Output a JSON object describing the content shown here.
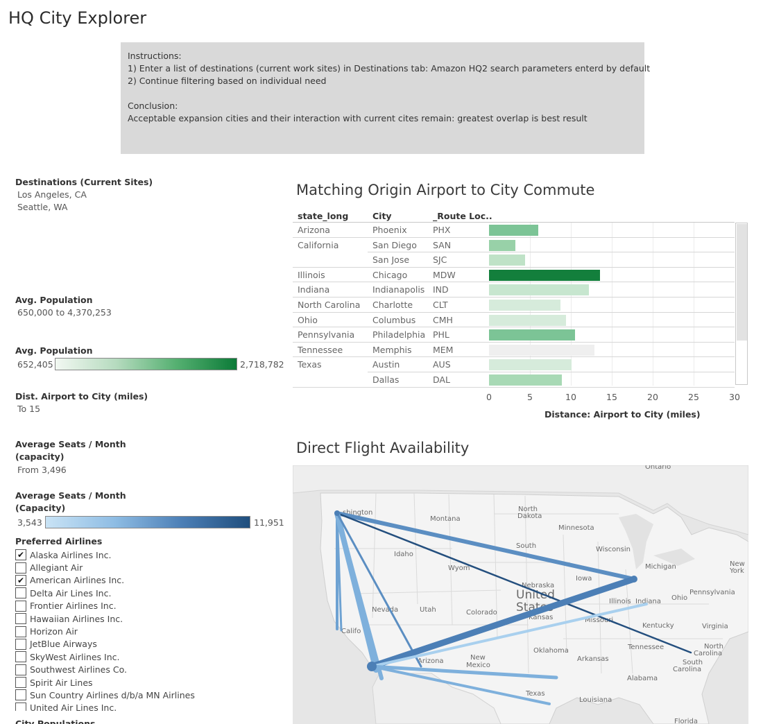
{
  "page_title": "HQ City Explorer",
  "instructions": {
    "heading": "Instructions:",
    "line1": "1) Enter a list of destinations (current work sites) in Destinations tab: Amazon HQ2 search parameters enterd by default",
    "line2": "2) Continue filtering based on individual need",
    "conclusion_heading": "Conclusion:",
    "conclusion": "Acceptable expansion cities and their interaction with current cites remain: greatest overlap is best result"
  },
  "filters": {
    "destinations": {
      "title": "Destinations (Current Sites)",
      "values": [
        "Los Angeles, CA",
        "Seattle, WA"
      ]
    },
    "avg_population_filter": {
      "title": "Avg. Population",
      "value": "650,000 to 4,370,253"
    },
    "avg_population_legend": {
      "title": "Avg. Population",
      "min": "652,405",
      "max": "2,718,782",
      "color_low": "#f2f8f2",
      "color_high": "#0c7b38"
    },
    "dist_filter": {
      "title": "Dist. Airport to City (miles)",
      "value": "To 15"
    },
    "seats_filter": {
      "title_line1": "Average Seats / Month",
      "title_line2": "(capacity)",
      "value": "From 3,496"
    },
    "seats_legend": {
      "title_line1": "Average Seats / Month",
      "title_line2": "(Capacity)",
      "min": "3,543",
      "max": "11,951",
      "color_low": "#c9e3f5",
      "color_high": "#1f4e7d"
    },
    "preferred_airlines": {
      "title": "Preferred Airlines",
      "items": [
        {
          "label": "Alaska Airlines Inc.",
          "checked": true,
          "mark": "✔"
        },
        {
          "label": "Allegiant Air",
          "checked": false,
          "mark": ""
        },
        {
          "label": "American Airlines Inc.",
          "checked": true,
          "mark": "✔"
        },
        {
          "label": "Delta Air Lines Inc.",
          "checked": false,
          "mark": ""
        },
        {
          "label": "Frontier Airlines Inc.",
          "checked": false,
          "mark": ""
        },
        {
          "label": "Hawaiian Airlines Inc.",
          "checked": false,
          "mark": ""
        },
        {
          "label": "Horizon Air",
          "checked": false,
          "mark": ""
        },
        {
          "label": "JetBlue Airways",
          "checked": false,
          "mark": ""
        },
        {
          "label": "SkyWest Airlines Inc.",
          "checked": false,
          "mark": ""
        },
        {
          "label": "Southwest Airlines Co.",
          "checked": false,
          "mark": ""
        },
        {
          "label": "Spirit Air Lines",
          "checked": false,
          "mark": ""
        },
        {
          "label": "Sun Country Airlines d/b/a MN Airlines",
          "checked": false,
          "mark": ""
        },
        {
          "label": "United Air Lines Inc.",
          "checked": false,
          "mark": ""
        }
      ]
    },
    "city_populations": {
      "title": "City Populations"
    }
  },
  "commute_table": {
    "title": "Matching Origin Airport to City Commute",
    "columns": {
      "state": "state_long",
      "city": "City",
      "route": "_Route Loc.."
    },
    "rows": [
      {
        "state": "Arizona",
        "city": "Phoenix",
        "code": "PHX",
        "distance": 6.0,
        "color": "#7cc496"
      },
      {
        "state": "California",
        "city": "San Diego",
        "code": "SAN",
        "distance": 3.2,
        "color": "#98d1a8"
      },
      {
        "state": "",
        "city": "San Jose",
        "code": "SJC",
        "distance": 4.4,
        "color": "#bfe2c7"
      },
      {
        "state": "Illinois",
        "city": "Chicago",
        "code": "MDW",
        "distance": 13.6,
        "color": "#137f3c"
      },
      {
        "state": "Indiana",
        "city": "Indianapolis",
        "code": "IND",
        "distance": 12.2,
        "color": "#c7e6cf"
      },
      {
        "state": "North Carolina",
        "city": "Charlotte",
        "code": "CLT",
        "distance": 8.7,
        "color": "#d6ebdb"
      },
      {
        "state": "Ohio",
        "city": "Columbus",
        "code": "CMH",
        "distance": 9.4,
        "color": "#d6ebdb"
      },
      {
        "state": "Pennsylvania",
        "city": "Philadelphia",
        "code": "PHL",
        "distance": 10.5,
        "color": "#7cc496"
      },
      {
        "state": "Tennessee",
        "city": "Memphis",
        "code": "MEM",
        "distance": 12.9,
        "color": "#efefef"
      },
      {
        "state": "Texas",
        "city": "Austin",
        "code": "AUS",
        "distance": 10.1,
        "color": "#d6ebdb"
      },
      {
        "state": "",
        "city": "Dallas",
        "code": "DAL",
        "distance": 8.9,
        "color": "#a8d9b5"
      }
    ],
    "x_ticks": [
      "0",
      "5",
      "10",
      "15",
      "20",
      "25",
      "30"
    ],
    "x_max": 30,
    "x_title": "Distance: Airport to City (miles)"
  },
  "flight_map": {
    "title": "Direct Flight Availability",
    "labels": [
      "Ontario",
      "shington",
      "Montana",
      "North",
      "Dakota",
      "Minnesota",
      "South",
      "Wisconsin",
      "Michigan",
      "New",
      "York",
      "Idaho",
      "Wyom",
      "Iowa",
      "Nebraska",
      "Pennsylvania",
      "Illinois",
      "Indiana",
      "Ohio",
      "United",
      "States",
      "Nevada",
      "Utah",
      "Colorado",
      "Kansas",
      "Missouri",
      "Kentucky",
      "Virginia",
      "Califo",
      "Oklahoma",
      "Tennessee",
      "North",
      "Carolina",
      "South",
      "Carolina",
      "Arizona",
      "New",
      "Mexico",
      "Arkansas",
      "Alabama",
      "Texas",
      "Louisiana",
      "Florida"
    ]
  }
}
